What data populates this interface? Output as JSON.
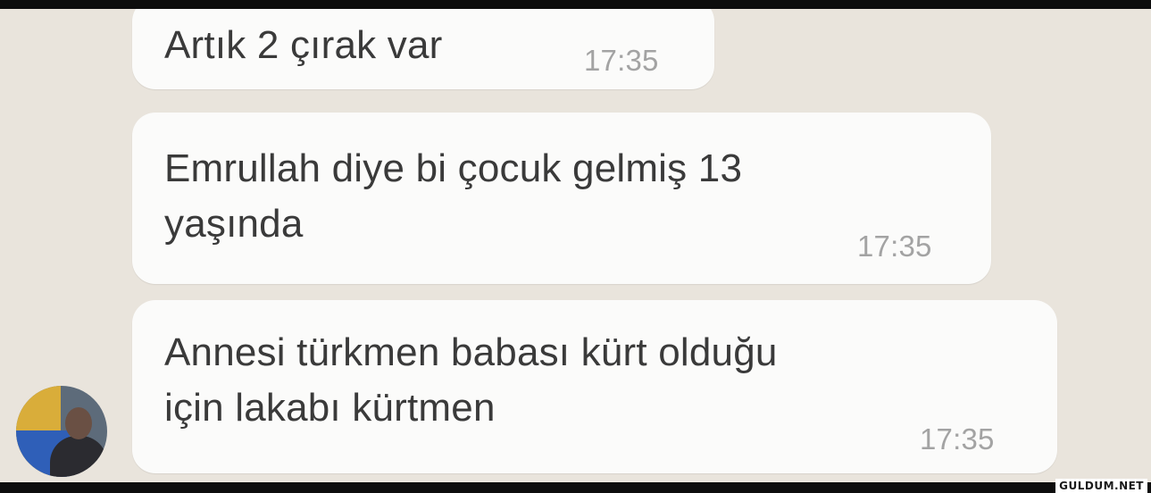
{
  "messages": [
    {
      "text": "Artık 2 çırak var",
      "time": "17:35"
    },
    {
      "text": "Emrullah diye bi çocuk gelmiş 13\nyaşında",
      "time": "17:35"
    },
    {
      "text": "Annesi türkmen babası kürt olduğu\niçin lakabı kürtmen",
      "time": "17:35"
    }
  ],
  "watermark": "GULDUM.NET",
  "colors": {
    "chat_background": "#e9e4dc",
    "bubble_background": "#fbfbfa",
    "message_text": "#3a3a3a",
    "timestamp_text": "#a3a3a3"
  }
}
